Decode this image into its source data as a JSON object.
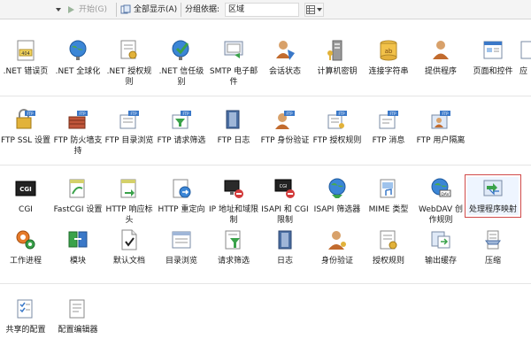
{
  "toolbar": {
    "start_label": "开始(G)",
    "show_all_label": "全部显示(A)",
    "group_by_label": "分组依据:",
    "group_by_value": "区域"
  },
  "sections": {
    "aspnet": [
      {
        "label": ".NET 错误页",
        "icon": "dotnet-error-pages-icon"
      },
      {
        "label": ".NET 全球化",
        "icon": "dotnet-globalization-icon"
      },
      {
        "label": ".NET 授权规则",
        "icon": "dotnet-authorization-icon"
      },
      {
        "label": ".NET 信任级别",
        "icon": "dotnet-trust-levels-icon"
      },
      {
        "label": "SMTP 电子邮件",
        "icon": "smtp-email-icon"
      },
      {
        "label": "会话状态",
        "icon": "session-state-icon"
      },
      {
        "label": "计算机密钥",
        "icon": "machine-key-icon"
      },
      {
        "label": "连接字符串",
        "icon": "connection-strings-icon"
      },
      {
        "label": "提供程序",
        "icon": "providers-icon"
      },
      {
        "label": "页面和控件",
        "icon": "pages-controls-icon"
      },
      {
        "label": "应",
        "icon": "app-settings-icon"
      }
    ],
    "ftp": [
      {
        "label": "FTP SSL 设置",
        "icon": "ftp-ssl-icon"
      },
      {
        "label": "FTP 防火墙支持",
        "icon": "ftp-firewall-icon"
      },
      {
        "label": "FTP 目录浏览",
        "icon": "ftp-directory-browsing-icon"
      },
      {
        "label": "FTP 请求筛选",
        "icon": "ftp-request-filtering-icon"
      },
      {
        "label": "FTP 日志",
        "icon": "ftp-logging-icon"
      },
      {
        "label": "FTP 身份验证",
        "icon": "ftp-authentication-icon"
      },
      {
        "label": "FTP 授权规则",
        "icon": "ftp-authorization-icon"
      },
      {
        "label": "FTP 消息",
        "icon": "ftp-messages-icon"
      },
      {
        "label": "FTP 用户隔离",
        "icon": "ftp-user-isolation-icon"
      }
    ],
    "iis_row1": [
      {
        "label": "CGI",
        "icon": "cgi-icon"
      },
      {
        "label": "FastCGI 设置",
        "icon": "fastcgi-icon"
      },
      {
        "label": "HTTP 响应标头",
        "icon": "http-response-headers-icon"
      },
      {
        "label": "HTTP 重定向",
        "icon": "http-redirect-icon"
      },
      {
        "label": "IP 地址和域限制",
        "icon": "ip-domain-restrictions-icon"
      },
      {
        "label": "ISAPI 和 CGI 限制",
        "icon": "isapi-cgi-restrictions-icon"
      },
      {
        "label": "ISAPI 筛选器",
        "icon": "isapi-filters-icon"
      },
      {
        "label": "MIME 类型",
        "icon": "mime-types-icon"
      },
      {
        "label": "WebDAV 创作规则",
        "icon": "webdav-icon"
      },
      {
        "label": "处理程序映射",
        "icon": "handler-mappings-icon"
      }
    ],
    "iis_row2": [
      {
        "label": "工作进程",
        "icon": "worker-processes-icon"
      },
      {
        "label": "模块",
        "icon": "modules-icon"
      },
      {
        "label": "默认文档",
        "icon": "default-document-icon"
      },
      {
        "label": "目录浏览",
        "icon": "directory-browsing-icon"
      },
      {
        "label": "请求筛选",
        "icon": "request-filtering-icon"
      },
      {
        "label": "日志",
        "icon": "logging-icon"
      },
      {
        "label": "身份验证",
        "icon": "authentication-icon"
      },
      {
        "label": "授权规则",
        "icon": "authorization-rules-icon"
      },
      {
        "label": "输出缓存",
        "icon": "output-caching-icon"
      },
      {
        "label": "压缩",
        "icon": "compression-icon"
      }
    ],
    "management": [
      {
        "label": "共享的配置",
        "icon": "shared-configuration-icon"
      },
      {
        "label": "配置编辑器",
        "icon": "configuration-editor-icon"
      }
    ]
  },
  "colors": {
    "selection_border": "#d04a4a",
    "accent_green": "#3aa24a",
    "accent_blue": "#2f6fc4"
  }
}
